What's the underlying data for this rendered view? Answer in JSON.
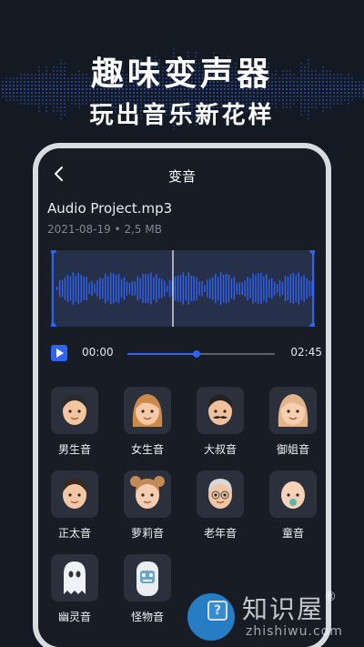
{
  "hero": {
    "title": "趣味变声器",
    "subtitle": "玩出音乐新花样"
  },
  "nav": {
    "title": "变音",
    "back_icon": "chevron-left-icon"
  },
  "file": {
    "name": "Audio Project.mp3",
    "meta": "2021-08-19 • 2,5 MB"
  },
  "player": {
    "current_time": "00:00",
    "duration": "02:45",
    "progress": 0.47,
    "accent_color": "#2f63f3"
  },
  "voices": [
    {
      "label": "男生音",
      "icon": "man-face-icon"
    },
    {
      "label": "女生音",
      "icon": "woman-face-icon"
    },
    {
      "label": "大叔音",
      "icon": "uncle-face-icon"
    },
    {
      "label": "御姐音",
      "icon": "lady-face-icon"
    },
    {
      "label": "正太音",
      "icon": "boy-face-icon"
    },
    {
      "label": "萝莉音",
      "icon": "girl-face-icon"
    },
    {
      "label": "老年音",
      "icon": "old-man-face-icon"
    },
    {
      "label": "童音",
      "icon": "baby-face-icon"
    },
    {
      "label": "幽灵音",
      "icon": "ghost-icon"
    },
    {
      "label": "怪物音",
      "icon": "monster-icon"
    }
  ],
  "watermark": {
    "title": "知识屋",
    "registered": "®",
    "url": "zhishiwu.com"
  }
}
